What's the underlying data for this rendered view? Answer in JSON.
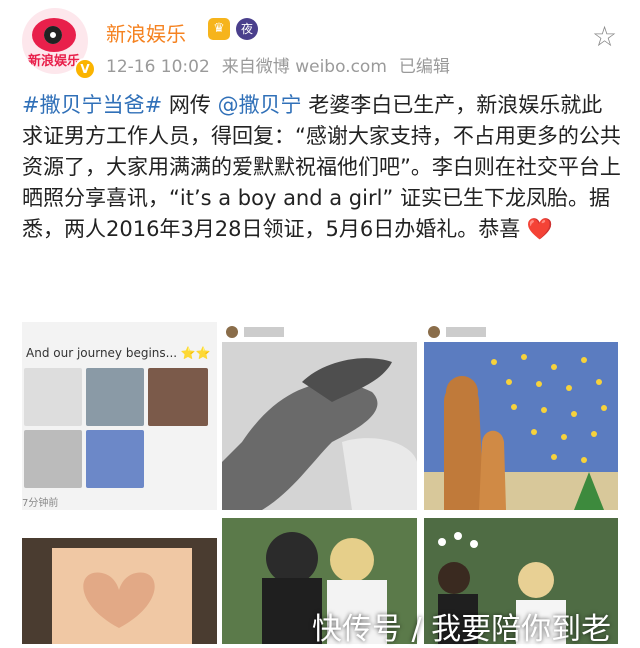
{
  "header": {
    "username": "新浪娱乐",
    "avatar_text": "新浪娱乐",
    "time": "12-16 10:02",
    "source": "来自微博 weibo.com",
    "edited": "已编辑",
    "badge_crown_icon": "crown-icon",
    "badge_night_text": "夜",
    "verified_icon": "verified-v-icon",
    "verified_text": "V"
  },
  "post": {
    "hashtag": "#撒贝宁当爸#",
    "text_1": " 网传 ",
    "mention": "@撒贝宁",
    "text_2": " 老婆李白已生产，新浪娱乐就此求证男方工作人员，得回复：“感谢大家支持，不占用更多的公共资源了，大家用满满的爱默默祝福他们吧”。李白则在社交平台上晒照分享喜讯，“it’s a boy and a girl” 证实已生下龙凤胎。据悉，两人2016年3月28日领证，5月6日办婚礼。恭喜 ",
    "heart": "❤️"
  },
  "photos": {
    "p1_caption": "And our journey begins... ⭐⭐",
    "p1_time": "7分钟前"
  },
  "watermark": "快传号 / 我要陪你到老",
  "colors": {
    "username": "#f58220",
    "link": "#3070b8",
    "meta": "#9a9a9a"
  }
}
